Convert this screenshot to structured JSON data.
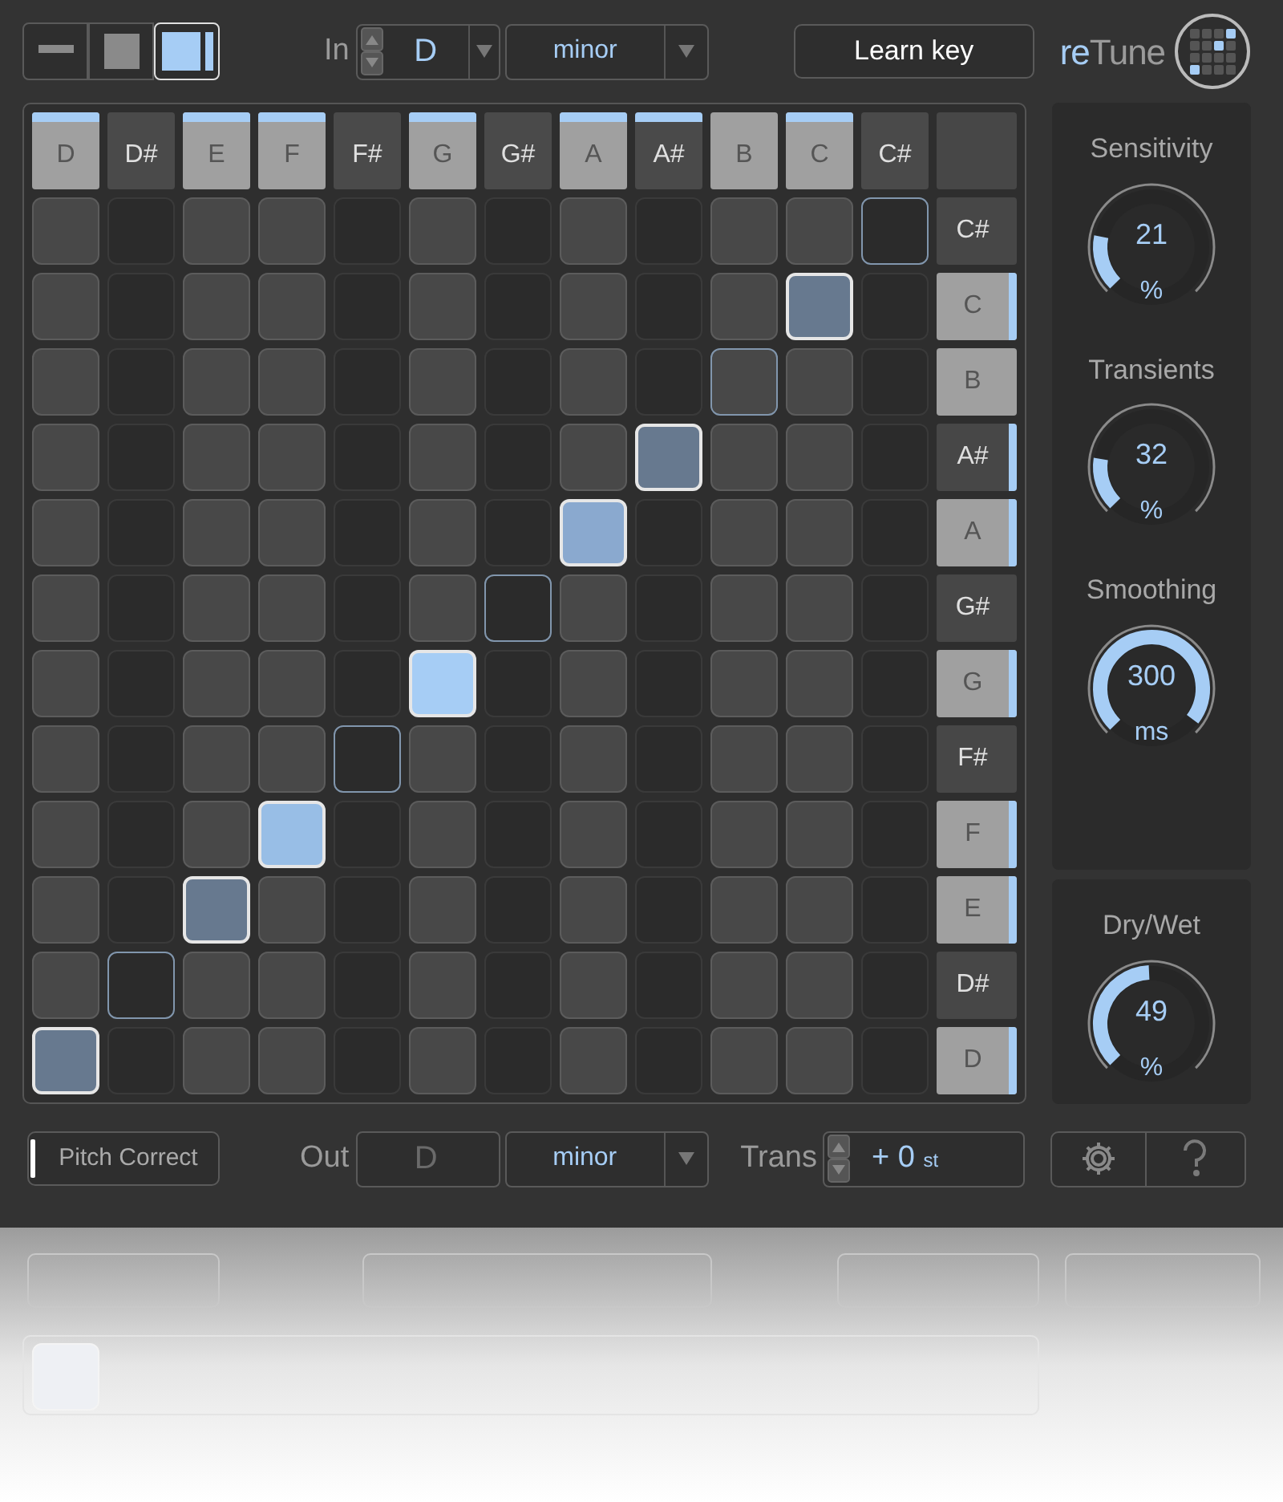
{
  "view_modes": [
    {
      "kind": "bar",
      "selected": false
    },
    {
      "kind": "square",
      "selected": false
    },
    {
      "kind": "panel",
      "selected": true
    }
  ],
  "input": {
    "label": "In",
    "key": "D",
    "stepper": true,
    "disabled": false,
    "scale": "minor"
  },
  "learn_button": "Learn key",
  "logo": {
    "prefix": "re",
    "name": "Tune"
  },
  "columns": [
    {
      "note": "D",
      "white": true,
      "in_scale": true
    },
    {
      "note": "D#",
      "white": false,
      "in_scale": false
    },
    {
      "note": "E",
      "white": true,
      "in_scale": true
    },
    {
      "note": "F",
      "white": true,
      "in_scale": true
    },
    {
      "note": "F#",
      "white": false,
      "in_scale": false
    },
    {
      "note": "G",
      "white": true,
      "in_scale": true
    },
    {
      "note": "G#",
      "white": false,
      "in_scale": false
    },
    {
      "note": "A",
      "white": true,
      "in_scale": true
    },
    {
      "note": "A#",
      "white": false,
      "in_scale": true
    },
    {
      "note": "B",
      "white": true,
      "in_scale": false
    },
    {
      "note": "C",
      "white": true,
      "in_scale": true
    },
    {
      "note": "C#",
      "white": false,
      "in_scale": false
    }
  ],
  "rows": [
    {
      "note": "C#",
      "white": false,
      "in_scale": false,
      "kind": "outline"
    },
    {
      "note": "C",
      "white": true,
      "in_scale": true,
      "kind": "filled",
      "color": "#67798f"
    },
    {
      "note": "B",
      "white": true,
      "in_scale": false,
      "kind": "outline"
    },
    {
      "note": "A#",
      "white": false,
      "in_scale": true,
      "kind": "filled",
      "color": "#67798f"
    },
    {
      "note": "A",
      "white": true,
      "in_scale": true,
      "kind": "filled",
      "color": "#8aa9cf"
    },
    {
      "note": "G#",
      "white": false,
      "in_scale": false,
      "kind": "outline"
    },
    {
      "note": "G",
      "white": true,
      "in_scale": true,
      "kind": "filled",
      "color": "#a6cdf5"
    },
    {
      "note": "F#",
      "white": false,
      "in_scale": false,
      "kind": "outline"
    },
    {
      "note": "F",
      "white": true,
      "in_scale": true,
      "kind": "filled",
      "color": "#98bee6"
    },
    {
      "note": "E",
      "white": true,
      "in_scale": true,
      "kind": "filled",
      "color": "#67798f"
    },
    {
      "note": "D#",
      "white": false,
      "in_scale": false,
      "kind": "outline"
    },
    {
      "note": "D",
      "white": true,
      "in_scale": true,
      "kind": "filled",
      "color": "#67798f"
    }
  ],
  "knob_groups": [
    [
      {
        "label": "Sensitivity",
        "value": "21",
        "unit": "%",
        "level": 0.21
      },
      {
        "label": "Transients",
        "value": "32",
        "unit": "%",
        "level": 0.2
      },
      {
        "label": "Smoothing",
        "value": "300",
        "unit": "ms",
        "level": 0.97
      }
    ],
    [
      {
        "label": "Dry/Wet",
        "value": "49",
        "unit": "%",
        "level": 0.49
      }
    ]
  ],
  "bottom": {
    "pitch_correct": {
      "label": "Pitch Correct",
      "on": true
    },
    "output": {
      "label": "Out",
      "key": "D",
      "stepper": false,
      "disabled": true,
      "scale": "minor"
    },
    "transpose": {
      "label": "Trans",
      "value": "+ 0",
      "unit": "st"
    }
  }
}
